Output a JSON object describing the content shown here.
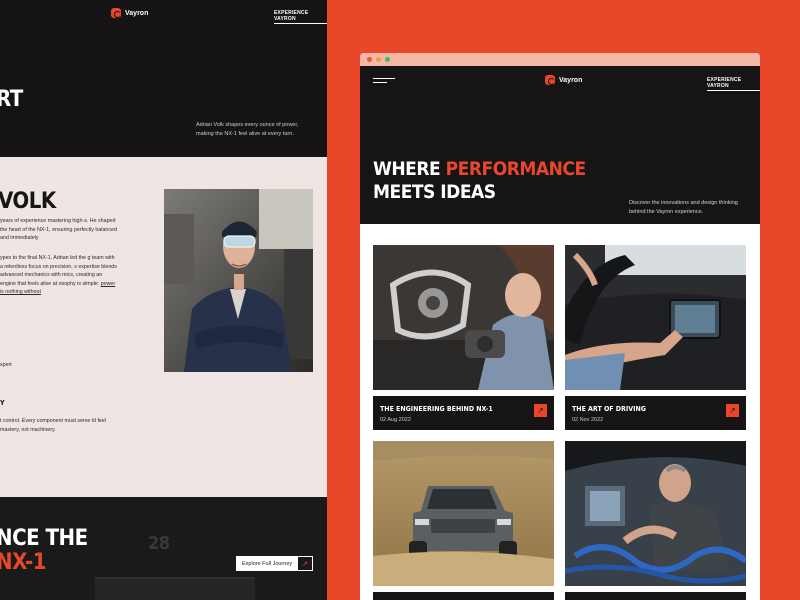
{
  "brand": {
    "name": "Vayron",
    "accent_color": "#e8472a",
    "dark_color": "#161414"
  },
  "left_page": {
    "nav": {
      "experience_link": "EXPERIENCE VAYRON"
    },
    "hero": {
      "title_line1": "",
      "title_line2": "RT",
      "description": "Adrian Volk shapes every ounce of power, making the NX-1 feel alive at every turn."
    },
    "about": {
      "name_heading": "VOLK",
      "paragraph1": "years of experience mastering high-s. He shaped the heart of the NX-1, ensuring perfectly balanced and immediately",
      "paragraph2_lead": "ypes to the final NX-1, Adrian led the g team with a relentless focus on precision, s expertise blends advanced mechanics with mics, creating an engine that feels alive at osophy is simple: ",
      "paragraph2_link": "power is nothing without",
      "stat_label": "xpert",
      "subheading": "Y",
      "paragraph3": "t control. Every component must serve ld feel mastery, not machinery."
    },
    "bottom": {
      "building_number": "28",
      "title_line1": "NCE THE",
      "title_line2": "NX-1",
      "cta_label": "Explore Full Journey",
      "cta_arrow": "↗"
    }
  },
  "browser": {
    "nav": {
      "menu_icon": "hamburger-icon",
      "experience_link": "EXPERIENCE VAYRON"
    },
    "hero": {
      "title_line1_plain": "WHERE ",
      "title_line1_accent": "PERFORMANCE",
      "title_line2": "MEETS IDEAS",
      "description": "Discover the innovations and design thinking behind the Vayron experience."
    },
    "cards": [
      {
        "title": "THE ENGINEERING BEHIND NX-1",
        "date": "02 Aug 2022",
        "image": "engine-parts-photo",
        "arrow": "↗"
      },
      {
        "title": "THE ART OF DRIVING",
        "date": "02 Nov 2022",
        "image": "car-dashboard-photo",
        "arrow": "↗"
      },
      {
        "title": "",
        "date": "",
        "image": "offroad-truck-photo",
        "arrow": "↗"
      },
      {
        "title": "",
        "date": "",
        "image": "mechanic-garage-photo",
        "arrow": "↗"
      }
    ]
  }
}
